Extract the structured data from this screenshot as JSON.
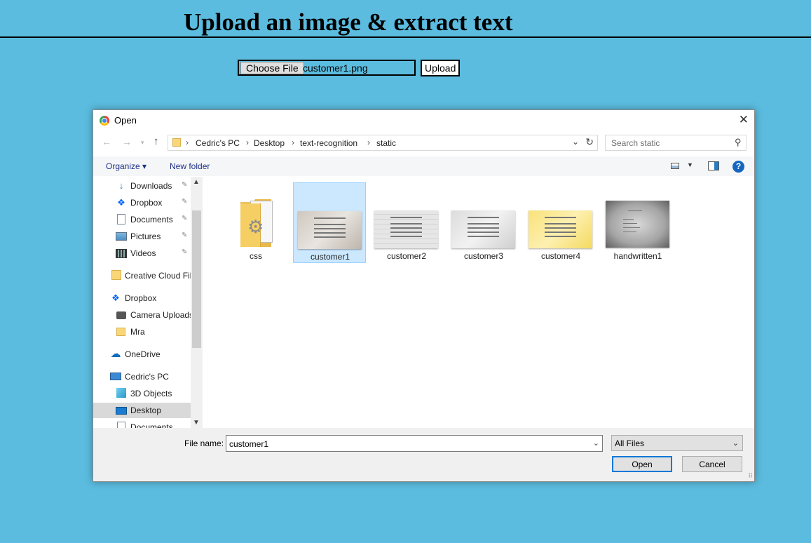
{
  "page": {
    "title": "Upload an image & extract text",
    "choose_file_label": "Choose File",
    "chosen_file": "customer1.png",
    "upload_label": "Upload"
  },
  "dialog": {
    "title": "Open",
    "breadcrumb": [
      "Cedric's PC",
      "Desktop",
      "text-recognition",
      "static"
    ],
    "search_placeholder": "Search static",
    "toolbar": {
      "organize": "Organize ▾",
      "new_folder": "New folder"
    },
    "nav_items": [
      {
        "label": "Downloads",
        "icon": "download-icon",
        "pinned": true
      },
      {
        "label": "Dropbox",
        "icon": "dropbox-icon",
        "pinned": true
      },
      {
        "label": "Documents",
        "icon": "document-icon",
        "pinned": true
      },
      {
        "label": "Pictures",
        "icon": "pictures-icon",
        "pinned": true
      },
      {
        "label": "Videos",
        "icon": "videos-icon",
        "pinned": true
      },
      {
        "label": "Creative Cloud Fil",
        "icon": "creative-cloud-icon"
      },
      {
        "label": "Dropbox",
        "icon": "dropbox-icon"
      },
      {
        "label": "Camera Uploads",
        "icon": "camera-icon"
      },
      {
        "label": "Mra",
        "icon": "folder-icon"
      },
      {
        "label": "OneDrive",
        "icon": "onedrive-icon"
      },
      {
        "label": "Cedric's PC",
        "icon": "computer-icon"
      },
      {
        "label": "3D Objects",
        "icon": "3d-objects-icon"
      },
      {
        "label": "Desktop",
        "icon": "desktop-icon",
        "selected": true
      },
      {
        "label": "Documents",
        "icon": "document-icon"
      }
    ],
    "files": [
      {
        "name": "css",
        "kind": "folder"
      },
      {
        "name": "customer1",
        "kind": "image",
        "selected": true
      },
      {
        "name": "customer2",
        "kind": "image"
      },
      {
        "name": "customer3",
        "kind": "image"
      },
      {
        "name": "customer4",
        "kind": "image"
      },
      {
        "name": "handwritten1",
        "kind": "image"
      }
    ],
    "file_name_label": "File name:",
    "file_name_value": "customer1",
    "filter_value": "All Files",
    "open_label": "Open",
    "cancel_label": "Cancel"
  },
  "colors": {
    "page_background": "#5bbcdf",
    "selection": "#cce8ff",
    "primary_button_border": "#0078d7"
  }
}
